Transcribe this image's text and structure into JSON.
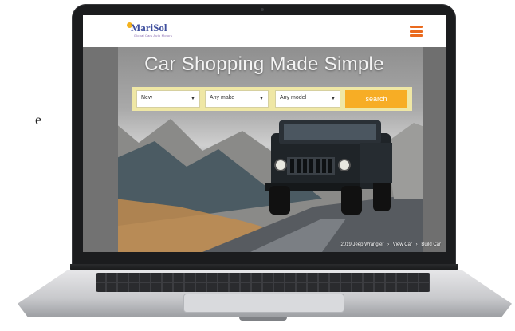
{
  "page": {
    "side_text": "e"
  },
  "site": {
    "logo": {
      "name": "MariSol",
      "tagline": "Global Cars Auto Motors"
    },
    "hero": {
      "title": "Car Shopping Made Simple"
    },
    "search": {
      "condition": {
        "value": "New"
      },
      "make": {
        "value": "Any make"
      },
      "model": {
        "value": "Any model"
      },
      "button_label": "search"
    },
    "caption": {
      "vehicle": "2019 Jeep Wrangler",
      "view_link": "View Car",
      "build_link": "Build Car"
    }
  },
  "colors": {
    "accent": "#f7ad25",
    "search_bar": "#efe7a5",
    "menu_icon": "#ea6a1e",
    "logo": "#3f4f9e"
  },
  "icons": {
    "menu": "hamburger-menu-icon",
    "dropdown": "chevron-down-icon"
  }
}
